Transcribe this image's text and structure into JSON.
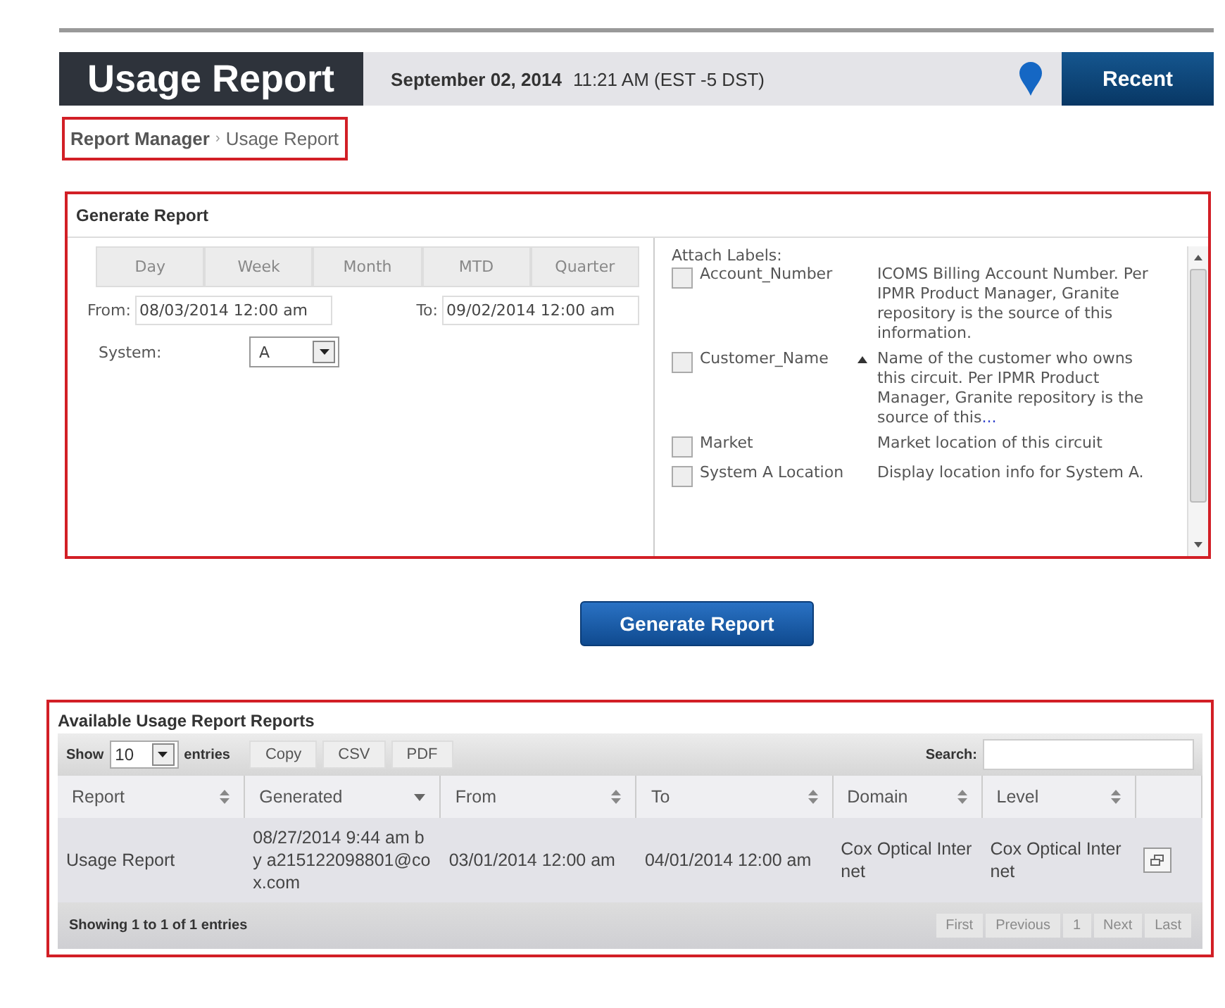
{
  "header": {
    "title": "Usage Report",
    "date": "September 02, 2014",
    "time": "11:21 AM (EST -5 DST)",
    "recent_button": "Recent"
  },
  "breadcrumb": {
    "items": [
      "Report Manager",
      "Usage Report"
    ],
    "separator": "›"
  },
  "generate": {
    "title": "Generate Report",
    "periods": [
      {
        "label": "Day",
        "selected": false
      },
      {
        "label": "Week",
        "selected": false
      },
      {
        "label": "Month",
        "selected": false
      },
      {
        "label": "MTD",
        "selected": false
      },
      {
        "label": "Quarter",
        "selected": false
      }
    ],
    "from_label": "From:",
    "from_value": "08/03/2014 12:00 am",
    "to_label": "To:",
    "to_value": "09/02/2014 12:00 am",
    "system_label": "System:",
    "system_value": "A",
    "labels_title": "Attach Labels:",
    "labels": [
      {
        "name": "Account_Number",
        "checked": false,
        "sorted": false,
        "description": "ICOMS Billing Account Number. Per IPMR Product Manager, Granite repository is the source of this information."
      },
      {
        "name": "Customer_Name",
        "checked": false,
        "sorted": true,
        "description": "Name of the customer who owns this circuit. Per IPMR Product Manager, Granite repository is the source of this",
        "more": "..."
      },
      {
        "name": "Market",
        "checked": false,
        "sorted": false,
        "description": "Market location of this circuit"
      },
      {
        "name": "System A Location",
        "checked": false,
        "sorted": false,
        "description": "Display location info for System A."
      }
    ],
    "button": "Generate Report"
  },
  "reports": {
    "title": "Available Usage Report Reports",
    "show_label": "Show",
    "page_size": "10",
    "entries_label": "entries",
    "export_buttons": [
      "Copy",
      "CSV",
      "PDF"
    ],
    "search_label": "Search:",
    "columns": [
      {
        "label": "Report",
        "sorted": false
      },
      {
        "label": "Generated",
        "sorted": true
      },
      {
        "label": "From",
        "sorted": false
      },
      {
        "label": "To",
        "sorted": false
      },
      {
        "label": "Domain",
        "sorted": false
      },
      {
        "label": "Level",
        "sorted": false
      }
    ],
    "rows": [
      {
        "cells": [
          "Usage Report",
          "08/27/2014 9:44 am by a215122098801@cox.com",
          "03/01/2014 12:00 am",
          "04/01/2014 12:00 am",
          "Cox Optical Internet",
          "Cox Optical Internet"
        ]
      }
    ],
    "info": "Showing 1 to 1 of 1 entries",
    "pagination": [
      {
        "label": "First",
        "disabled": true
      },
      {
        "label": "Previous",
        "disabled": true
      },
      {
        "label": "1",
        "disabled": true
      },
      {
        "label": "Next",
        "disabled": true
      },
      {
        "label": "Last",
        "disabled": true
      }
    ]
  }
}
